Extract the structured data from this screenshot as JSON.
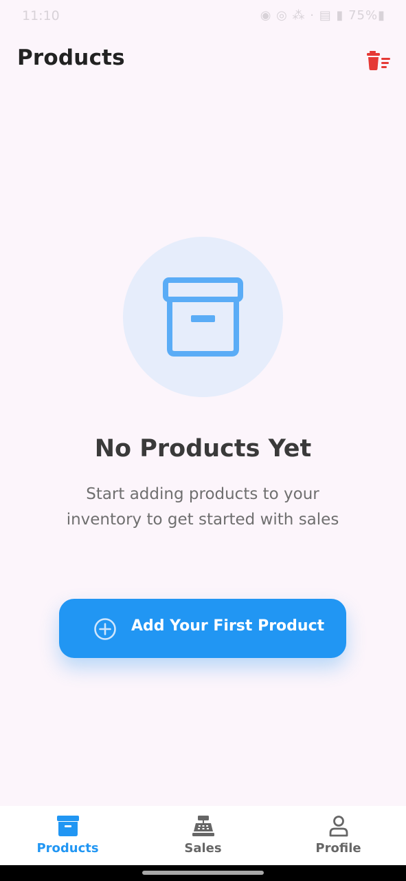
{
  "status_bar": {
    "time": "11:10",
    "icons": "◉ ◎ ⁂ · ▤ ▮ 75%▮"
  },
  "header": {
    "title": "Products",
    "delete_all_icon": "trash-list-icon",
    "accent_color": "#e53935"
  },
  "empty_state": {
    "icon": "archive-box-icon",
    "title": "No Products Yet",
    "message": "Start adding products to your inventory to get started with sales",
    "button_label": "Add Your First Product",
    "button_icon": "plus-circle-icon",
    "primary_color": "#2196f3"
  },
  "bottom_nav": {
    "items": [
      {
        "label": "Products",
        "icon": "archive-box-icon",
        "active": true
      },
      {
        "label": "Sales",
        "icon": "cash-register-icon",
        "active": false
      },
      {
        "label": "Profile",
        "icon": "person-icon",
        "active": false
      }
    ],
    "active_color": "#2196f3",
    "inactive_color": "#666666"
  }
}
